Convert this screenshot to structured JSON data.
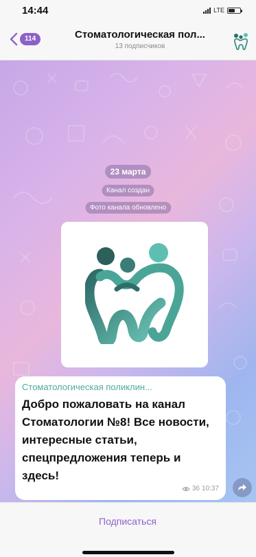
{
  "status_bar": {
    "time": "14:44",
    "network": "LTE"
  },
  "header": {
    "back_badge": "114",
    "title": "Стоматологическая пол...",
    "subtitle": "13 подписчиков",
    "avatar_icon": "tooth-family-icon"
  },
  "chat": {
    "date": "23 марта",
    "service_created": "Канал создан",
    "service_photo": "Фото канала обновлено",
    "photo_icon": "tooth-family-logo",
    "message": {
      "author": "Стоматологическая поликлин...",
      "text": "Добро пожаловать на канал Стоматологии №8! Все новости, интересные статьи, спецпредложения теперь и здесь!",
      "views": "36",
      "time": "10:37"
    }
  },
  "bottom": {
    "subscribe_label": "Подписаться"
  },
  "colors": {
    "accent": "#8d62c7",
    "author": "#4fa99a",
    "logo_dark": "#2f6d68",
    "logo_light": "#5ebfb0"
  }
}
